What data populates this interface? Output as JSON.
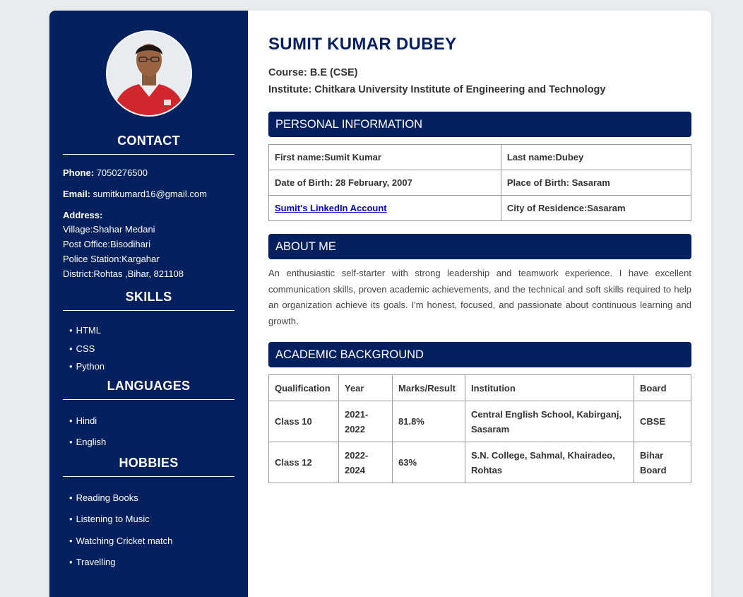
{
  "header": {
    "name": "SUMIT KUMAR DUBEY",
    "course": "Course: B.E (CSE)",
    "institute": "Institute: Chitkara University Institute of Engineering and Technology"
  },
  "sidebar": {
    "contact_title": "CONTACT",
    "phone_label": "Phone:",
    "phone": "7050276500",
    "email_label": "Email:",
    "email": "sumitkumard16@gmail.com",
    "address_label": "Address:",
    "address_lines": [
      "Village:Shahar Medani",
      "Post Office:Bisodihari",
      "Police Station:Kargahar",
      "District:Rohtas ,Bihar, 821108"
    ],
    "skills_title": "SKILLS",
    "skills": [
      "HTML",
      "CSS",
      "Python"
    ],
    "languages_title": "LANGUAGES",
    "languages": [
      "Hindi",
      "English"
    ],
    "hobbies_title": "HOBBIES",
    "hobbies": [
      "Reading Books",
      "Listening to Music",
      "Watching Cricket match",
      "Travelling"
    ]
  },
  "personal": {
    "title": "PERSONAL INFORMATION",
    "first_name": "First name:Sumit Kumar",
    "last_name": "Last name:Dubey",
    "dob": "Date of Birth: 28 February, 2007",
    "pob": "Place of Birth: Sasaram",
    "linkedin": "Sumit's LinkedIn Account",
    "city": "City of Residence:Sasaram"
  },
  "about": {
    "title": "ABOUT ME",
    "text": "An enthusiastic self-starter with strong leadership and teamwork experience. I have excellent communication skills, proven academic achievements, and the technical and soft skills required to help an organization achieve its goals. I'm honest, focused, and passionate about continuous learning and growth."
  },
  "academic": {
    "title": "ACADEMIC BACKGROUND",
    "headers": [
      "Qualification",
      "Year",
      "Marks/Result",
      "Institution",
      "Board"
    ],
    "rows": [
      [
        "Class 10",
        "2021-2022",
        "81.8%",
        "Central English School, Kabirganj, Sasaram",
        "CBSE"
      ],
      [
        "Class 12",
        "2022-2024",
        "63%",
        "S.N. College, Sahmal, Khairadeo, Rohtas",
        "Bihar Board"
      ]
    ]
  },
  "colors": {
    "navy": "#04205e",
    "link": "#0000cc"
  },
  "icons": {
    "profile_photo": "person-photo"
  }
}
